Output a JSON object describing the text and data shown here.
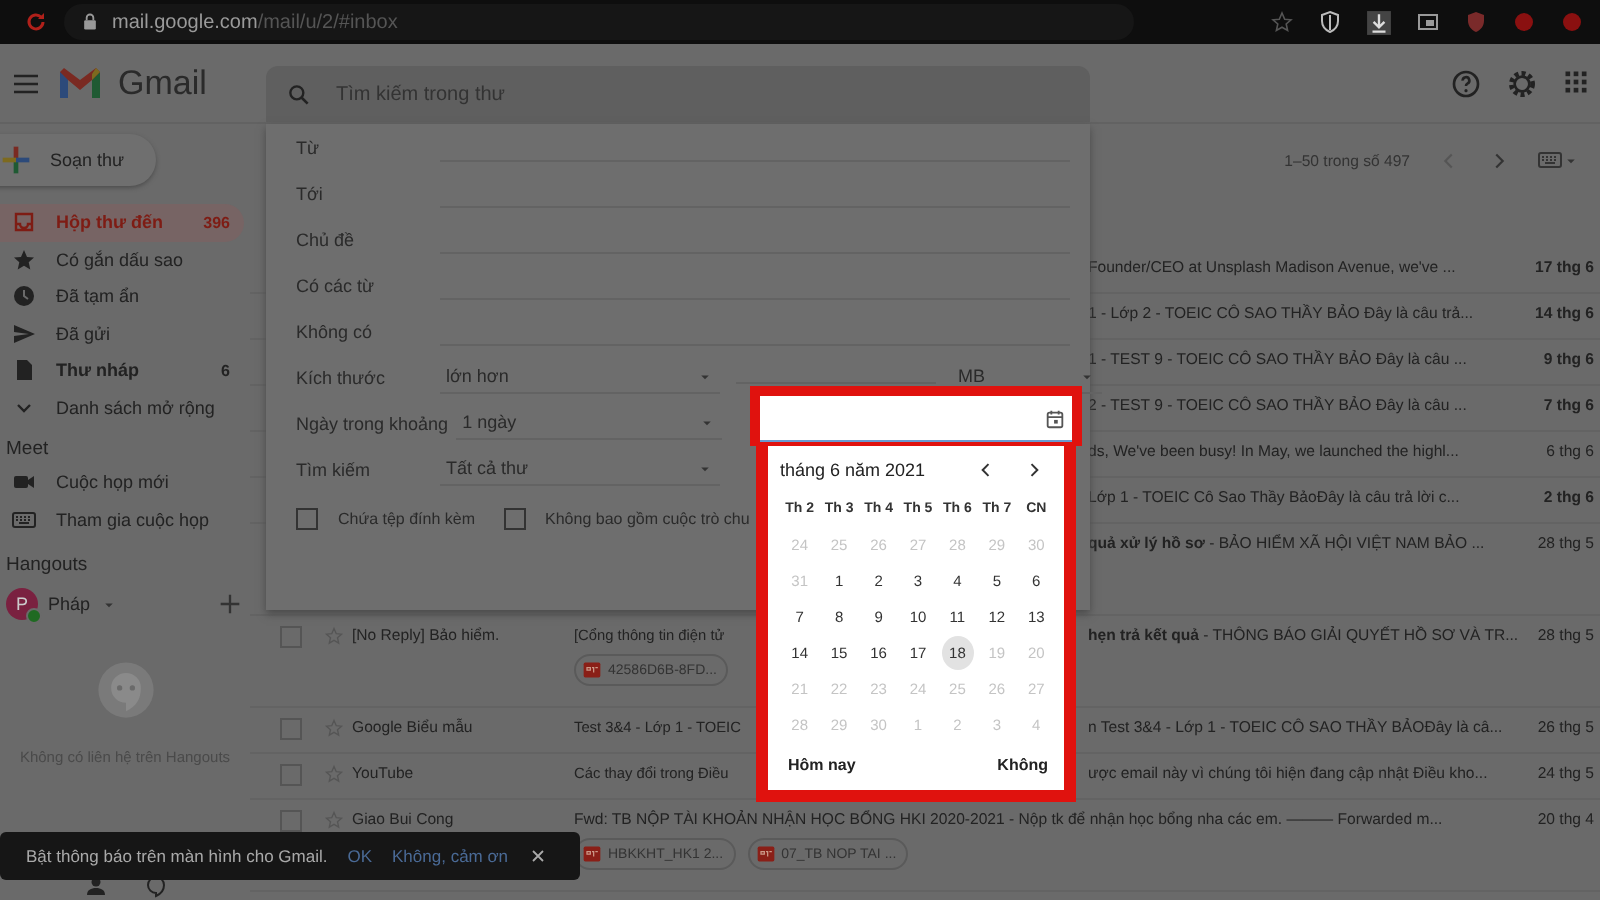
{
  "browser": {
    "url_host": "mail.google.com",
    "url_path": "/mail/u/2/#inbox"
  },
  "header": {
    "app_name": "Gmail",
    "search": {
      "placeholder": "Tìm kiếm trong thư"
    }
  },
  "sidebar": {
    "compose": "Soạn thư",
    "items": [
      {
        "label": "Hộp thư đến",
        "count": "396",
        "selected": true,
        "bold": true
      },
      {
        "label": "Có gắn dấu sao",
        "selected": false,
        "bold": false
      },
      {
        "label": "Đã tạm ẩn",
        "selected": false,
        "bold": false
      },
      {
        "label": "Đã gửi",
        "selected": false,
        "bold": false
      },
      {
        "label": "Thư nháp",
        "count": "6",
        "selected": false,
        "bold": true
      },
      {
        "label": "Danh sách mở rộng",
        "selected": false,
        "bold": false
      }
    ],
    "meet": {
      "title": "Meet",
      "items": [
        {
          "label": "Cuộc họp mới"
        },
        {
          "label": "Tham gia cuộc họp"
        }
      ]
    },
    "hangouts": {
      "title": "Hangouts",
      "user": {
        "initial": "P",
        "name": "Pháp",
        "online": true
      },
      "empty_text": "Không có liên hệ trên Hangouts"
    }
  },
  "toolbar": {
    "range": "1–50 trong số 497"
  },
  "emails": [
    {
      "kind": "covered",
      "snippet": "Founder/CEO at Unsplash Madison Avenue, we've ...",
      "date": "17 thg 6",
      "unread": true
    },
    {
      "kind": "covered",
      "snippet": "1 - Lớp 2 - TOEIC CÔ SAO THẦY BẢO Đây là câu trả...",
      "date": "14 thg 6",
      "unread": true
    },
    {
      "kind": "covered",
      "snippet": "1 - TEST 9 - TOEIC CÔ SAO THẦY BẢO Đây là câu ...",
      "date": "9 thg 6",
      "unread": true
    },
    {
      "kind": "covered",
      "snippet": "2 - TEST 9 - TOEIC CÔ SAO THẦY BẢO Đây là câu ...",
      "date": "7 thg 6",
      "unread": true
    },
    {
      "kind": "covered",
      "snippet": "ds, We've been busy! In May, we launched the highl...",
      "date": "6 thg 6",
      "unread": false
    },
    {
      "kind": "covered",
      "snippet": "Lớp 1 - TOEIC Cô Sao Thầy BảoĐây là câu trả lời c...",
      "date": "2 thg 6",
      "unread": true
    },
    {
      "kind": "covered-tall",
      "snippet": "**quả xử lý hồ sơ** - BẢO HIỂM XÃ HỘI VIỆT NAM BẢO ...",
      "date": "28 thg 5",
      "unread": false
    },
    {
      "kind": "partial",
      "checked": false,
      "sender": "[No Reply] Bảo hiểm.",
      "subject_start": "[Cổng thông tin điện tử",
      "snippet": "**hẹn trả kết quả** - THÔNG BÁO GIẢI QUYẾT HỒ SƠ VÀ TR...",
      "date": "28 thg 5",
      "unread": false,
      "attachments": [
        "42586D6B-8FD..."
      ]
    },
    {
      "kind": "partial",
      "checked": false,
      "sender": "Google Biểu mẫu",
      "subject_start": "Test 3&4 - Lớp 1 - TOEIC",
      "snippet": "n Test 3&4 - Lớp 1 - TOEIC CÔ SAO THẦY BẢOĐây là câ...",
      "date": "26 thg 5",
      "unread": false
    },
    {
      "kind": "partial",
      "checked": false,
      "sender": "YouTube",
      "subject_start": "Các thay đổi trong Điều",
      "snippet": "ược email này vì chúng tôi hiện đang cập nhật Điều kho...",
      "date": "24 thg 5",
      "unread": false
    },
    {
      "kind": "full",
      "checked": false,
      "sender": "Giao Bui Cong",
      "snippet": "Fwd: TB NỘP TÀI KHOẢN NHẬN HỌC BỔNG HKI 2020-2021 - Nộp tk để nhận học bổng nha các em. ——— Forwarded m...",
      "date": "20 thg 4",
      "unread": false,
      "attachments": [
        "HBKKHT_HK1 2...",
        "07_TB NOP TAI ..."
      ]
    }
  ],
  "advanced_search": {
    "fields": [
      {
        "kind": "text",
        "label": "Từ"
      },
      {
        "kind": "text",
        "label": "Tới"
      },
      {
        "kind": "text",
        "label": "Chủ đề"
      },
      {
        "kind": "text",
        "label": "Có các từ"
      },
      {
        "kind": "text",
        "label": "Không có"
      },
      {
        "kind": "size",
        "label": "Kích thước",
        "value": "lớn hơn",
        "unit": "MB"
      },
      {
        "kind": "date",
        "label": "Ngày trong khoảng",
        "value": "1 ngày"
      },
      {
        "kind": "select",
        "label": "Tìm kiếm",
        "value": "Tất cả thư"
      }
    ],
    "checkboxes": [
      {
        "label": "Chứa tệp đính kèm",
        "checked": false
      },
      {
        "label": "Không bao gồm cuộc trò chu",
        "checked": false
      }
    ]
  },
  "date_picker": {
    "title": "tháng 6 năm 2021",
    "weekdays": [
      "Th 2",
      "Th 3",
      "Th 4",
      "Th 5",
      "Th 6",
      "Th 7",
      "CN"
    ],
    "days": [
      {
        "label": "24",
        "disabled": true,
        "selected": false
      },
      {
        "label": "25",
        "disabled": true,
        "selected": false
      },
      {
        "label": "26",
        "disabled": true,
        "selected": false
      },
      {
        "label": "27",
        "disabled": true,
        "selected": false
      },
      {
        "label": "28",
        "disabled": true,
        "selected": false
      },
      {
        "label": "29",
        "disabled": true,
        "selected": false
      },
      {
        "label": "30",
        "disabled": true,
        "selected": false
      },
      {
        "label": "31",
        "disabled": true,
        "selected": false
      },
      {
        "label": "1",
        "disabled": false,
        "selected": false
      },
      {
        "label": "2",
        "disabled": false,
        "selected": false
      },
      {
        "label": "3",
        "disabled": false,
        "selected": false
      },
      {
        "label": "4",
        "disabled": false,
        "selected": false
      },
      {
        "label": "5",
        "disabled": false,
        "selected": false
      },
      {
        "label": "6",
        "disabled": false,
        "selected": false
      },
      {
        "label": "7",
        "disabled": false,
        "selected": false
      },
      {
        "label": "8",
        "disabled": false,
        "selected": false
      },
      {
        "label": "9",
        "disabled": false,
        "selected": false
      },
      {
        "label": "10",
        "disabled": false,
        "selected": false
      },
      {
        "label": "11",
        "disabled": false,
        "selected": false
      },
      {
        "label": "12",
        "disabled": false,
        "selected": false
      },
      {
        "label": "13",
        "disabled": false,
        "selected": false
      },
      {
        "label": "14",
        "disabled": false,
        "selected": false
      },
      {
        "label": "15",
        "disabled": false,
        "selected": false
      },
      {
        "label": "16",
        "disabled": false,
        "selected": false
      },
      {
        "label": "17",
        "disabled": false,
        "selected": false
      },
      {
        "label": "18",
        "disabled": false,
        "selected": true
      },
      {
        "label": "19",
        "disabled": true,
        "selected": false
      },
      {
        "label": "20",
        "disabled": true,
        "selected": false
      },
      {
        "label": "21",
        "disabled": true,
        "selected": false
      },
      {
        "label": "22",
        "disabled": true,
        "selected": false
      },
      {
        "label": "23",
        "disabled": true,
        "selected": false
      },
      {
        "label": "24",
        "disabled": true,
        "selected": false
      },
      {
        "label": "25",
        "disabled": true,
        "selected": false
      },
      {
        "label": "26",
        "disabled": true,
        "selected": false
      },
      {
        "label": "27",
        "disabled": true,
        "selected": false
      },
      {
        "label": "28",
        "disabled": true,
        "selected": false
      },
      {
        "label": "29",
        "disabled": true,
        "selected": false
      },
      {
        "label": "30",
        "disabled": true,
        "selected": false
      },
      {
        "label": "1",
        "disabled": true,
        "selected": false
      },
      {
        "label": "2",
        "disabled": true,
        "selected": false
      },
      {
        "label": "3",
        "disabled": true,
        "selected": false
      },
      {
        "label": "4",
        "disabled": true,
        "selected": false
      }
    ],
    "today_button": "Hôm nay",
    "clear_button": "Không"
  },
  "toast": {
    "message": "Bật thông báo trên màn hình cho Gmail.",
    "actions": [
      "OK",
      "Không, cảm ơn"
    ]
  }
}
